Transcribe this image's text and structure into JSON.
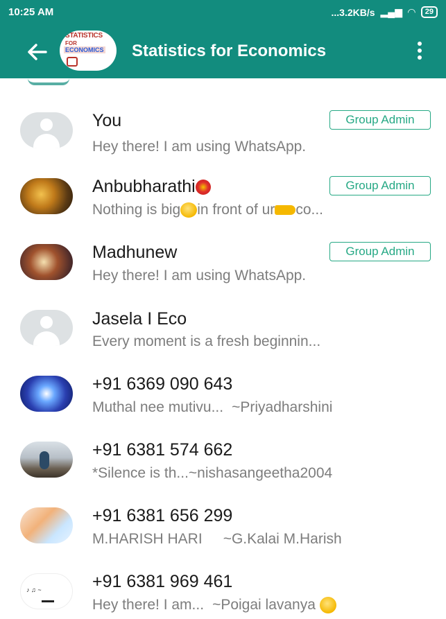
{
  "status_bar": {
    "time": "10:25 AM",
    "network": "...3.2KB/s",
    "battery": "29"
  },
  "header": {
    "group_avatar_text": [
      "STATISTICS",
      "FOR",
      "ECONOMICS"
    ],
    "title": "Statistics for Economics",
    "back_icon": "arrow-left-icon",
    "menu_icon": "more-vert-icon"
  },
  "participants": [
    {
      "name": "You",
      "status": "Hey there! I am using WhatsApp.",
      "badge": "Group Admin",
      "avatar": "default"
    },
    {
      "name": "Anbubharathi",
      "status_a": "Nothing is big",
      "status_b": "in front of ur",
      "status_c": "co...",
      "badge": "Group Admin",
      "avatar": "photo"
    },
    {
      "name": "Madhunew",
      "status": "Hey there! I am using WhatsApp.",
      "badge": "Group Admin",
      "avatar": "photo"
    },
    {
      "name": "Jasela I Eco",
      "status": "Every moment is a fresh beginnin...",
      "avatar": "default"
    },
    {
      "name": "+91 6369 090 643",
      "status": "Muthal nee mutivu...",
      "about": "~Priyadharshini",
      "avatar": "photo"
    },
    {
      "name": "+91 6381 574 662",
      "status": "*Silence is th...",
      "about": "~nishasangeetha2004",
      "avatar": "photo"
    },
    {
      "name": "+91 6381 656 299",
      "status": "M.HARISH HARI",
      "about": "~G.Kalai M.Harish",
      "avatar": "photo"
    },
    {
      "name": "+91 6381 969 461",
      "status": "Hey there! I am...",
      "about": "~Poigai lavanya",
      "avatar": "photo"
    }
  ],
  "colors": {
    "header_bg": "#128C7E",
    "admin_badge": "#25a884",
    "secondary_text": "#7d7d7d"
  }
}
